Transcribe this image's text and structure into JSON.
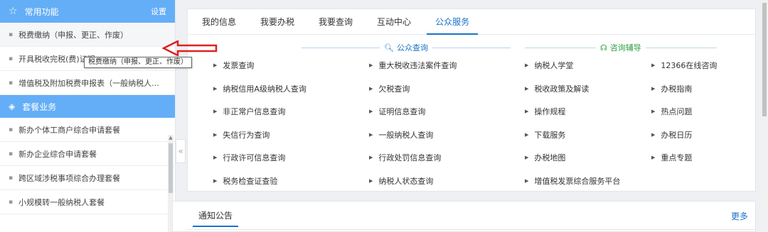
{
  "sidebar": {
    "common": {
      "title": "常用功能",
      "settings_label": "设置",
      "items": [
        {
          "label": "税费缴纳（申报、更正、作废）"
        },
        {
          "label": "开具税收完税(费)证明"
        },
        {
          "label": "增值税及附加税费申报表（一般纳税人..."
        }
      ]
    },
    "packages": {
      "title": "套餐业务",
      "items": [
        {
          "label": "新办个体工商户综合申请套餐"
        },
        {
          "label": "新办企业综合申请套餐"
        },
        {
          "label": "跨区域涉税事项综合办理套餐"
        },
        {
          "label": "小规模转一般纳税人套餐"
        }
      ]
    },
    "collapse_label": "«"
  },
  "tooltip": {
    "text": "税费缴纳（申报、更正、作废）"
  },
  "main": {
    "tabs": [
      {
        "label": "我的信息"
      },
      {
        "label": "我要办税"
      },
      {
        "label": "我要查询"
      },
      {
        "label": "互动中心"
      },
      {
        "label": "公众服务"
      }
    ],
    "active_tab": "公众服务",
    "sections": {
      "query": {
        "title": "公众查询",
        "icon": "search-doc-icon"
      },
      "consult": {
        "title": "咨询辅导",
        "icon": "headset-icon"
      }
    },
    "grid": [
      [
        "发票查询",
        "重大税收违法案件查询",
        "纳税人学堂",
        "12366在线咨询"
      ],
      [
        "纳税信用A级纳税人查询",
        "欠税查询",
        "税收政策及解读",
        "办税指南"
      ],
      [
        "非正常户信息查询",
        "证明信息查询",
        "操作规程",
        "热点问题"
      ],
      [
        "失信行为查询",
        "一般纳税人查询",
        "下载服务",
        "办税日历"
      ],
      [
        "行政许可信息查询",
        "行政处罚信息查询",
        "办税地图",
        "重点专题"
      ],
      [
        "税务检查证查验",
        "纳税人状态查询",
        "增值税发票综合服务平台",
        ""
      ]
    ]
  },
  "notice": {
    "tab_label": "通知公告",
    "more_label": "更多"
  },
  "colors": {
    "accent": "#1a73c8",
    "sidebar_header": "#64aef7",
    "consult_green": "#2ea043",
    "arrow_red": "#e02020"
  }
}
